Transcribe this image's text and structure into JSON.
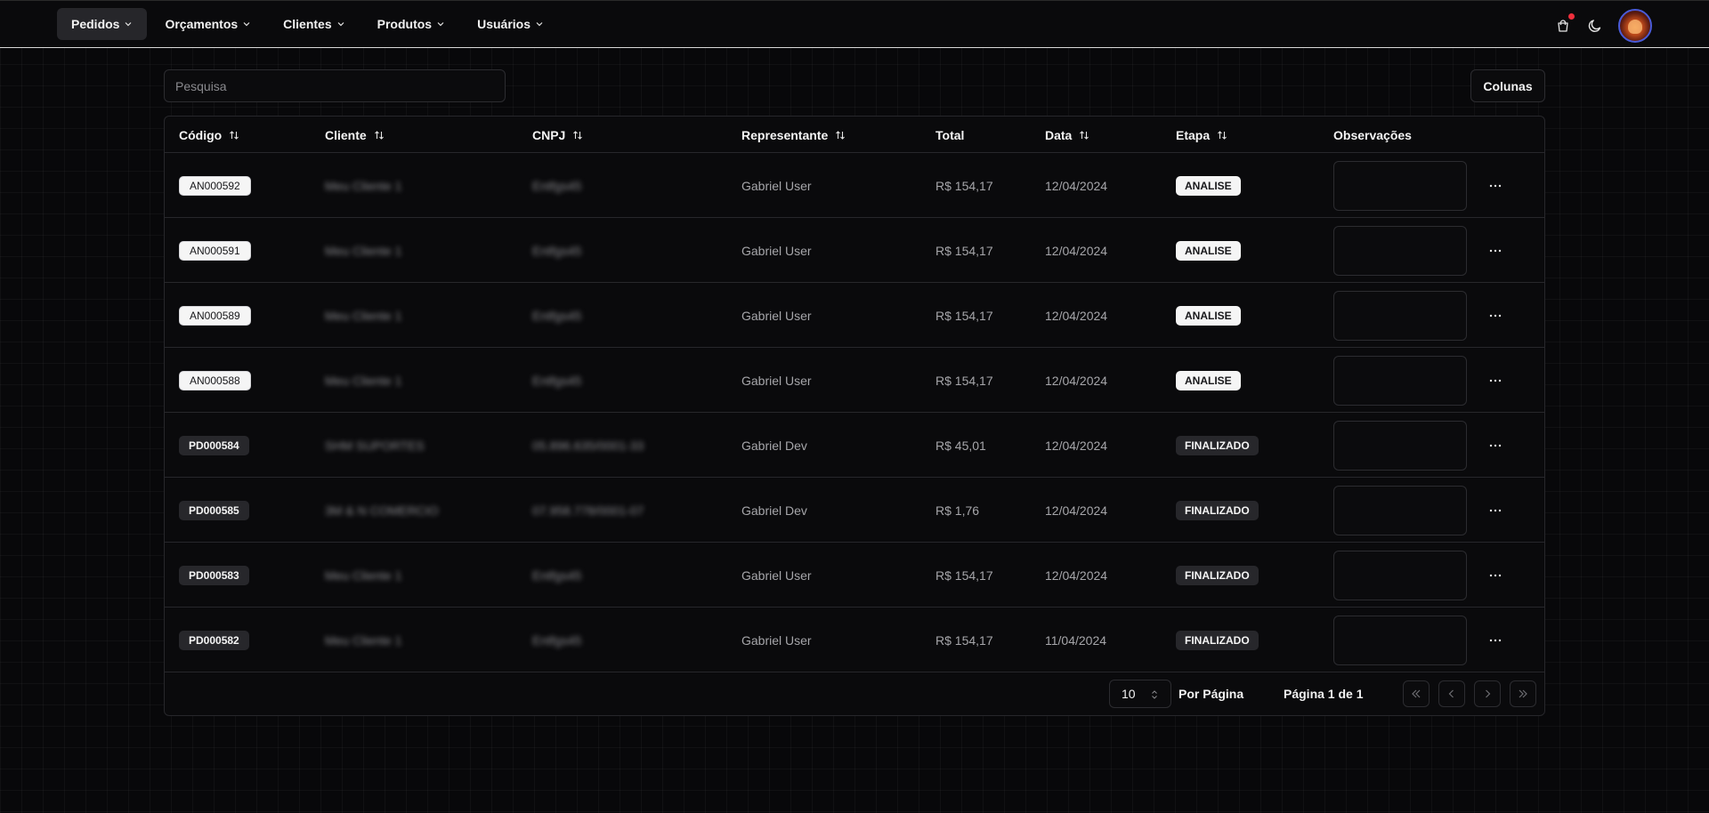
{
  "nav": {
    "items": [
      {
        "label": "Pedidos",
        "active": true
      },
      {
        "label": "Orçamentos",
        "active": false
      },
      {
        "label": "Clientes",
        "active": false
      },
      {
        "label": "Produtos",
        "active": false
      },
      {
        "label": "Usuários",
        "active": false
      }
    ],
    "icons": [
      "cart-icon",
      "moon-icon"
    ],
    "notification_color": "#ef2f3c"
  },
  "toolbar": {
    "search_placeholder": "Pesquisa",
    "columns_label": "Colunas"
  },
  "table": {
    "headers": {
      "code": "Código",
      "client": "Cliente",
      "cnpj": "CNPJ",
      "rep": "Representante",
      "total": "Total",
      "date": "Data",
      "stage": "Etapa",
      "obs": "Observações"
    },
    "rows": [
      {
        "code": "AN000592",
        "code_style": "light",
        "client": "Meu Cliente 1",
        "cnpj": "Entfgs45",
        "rep": "Gabriel User",
        "total": "R$ 154,17",
        "date": "12/04/2024",
        "stage": "ANALISE",
        "stage_style": "light"
      },
      {
        "code": "AN000591",
        "code_style": "light",
        "client": "Meu Cliente 1",
        "cnpj": "Entfgs45",
        "rep": "Gabriel User",
        "total": "R$ 154,17",
        "date": "12/04/2024",
        "stage": "ANALISE",
        "stage_style": "light"
      },
      {
        "code": "AN000589",
        "code_style": "light",
        "client": "Meu Cliente 1",
        "cnpj": "Entfgs45",
        "rep": "Gabriel User",
        "total": "R$ 154,17",
        "date": "12/04/2024",
        "stage": "ANALISE",
        "stage_style": "light"
      },
      {
        "code": "AN000588",
        "code_style": "light",
        "client": "Meu Cliente 1",
        "cnpj": "Entfgs45",
        "rep": "Gabriel User",
        "total": "R$ 154,17",
        "date": "12/04/2024",
        "stage": "ANALISE",
        "stage_style": "light"
      },
      {
        "code": "PD000584",
        "code_style": "dark",
        "client": "SHM SUPORTES",
        "cnpj": "05.896.635/0001-33",
        "rep": "Gabriel Dev",
        "total": "R$ 45,01",
        "date": "12/04/2024",
        "stage": "FINALIZADO",
        "stage_style": "dark"
      },
      {
        "code": "PD000585",
        "code_style": "dark",
        "client": "3M & N COMERCIO",
        "cnpj": "07.958.778/0001-07",
        "rep": "Gabriel Dev",
        "total": "R$ 1,76",
        "date": "12/04/2024",
        "stage": "FINALIZADO",
        "stage_style": "dark"
      },
      {
        "code": "PD000583",
        "code_style": "dark",
        "client": "Meu Cliente 1",
        "cnpj": "Entfgs45",
        "rep": "Gabriel User",
        "total": "R$ 154,17",
        "date": "12/04/2024",
        "stage": "FINALIZADO",
        "stage_style": "dark"
      },
      {
        "code": "PD000582",
        "code_style": "dark",
        "client": "Meu Cliente 1",
        "cnpj": "Entfgs45",
        "rep": "Gabriel User",
        "total": "R$ 154,17",
        "date": "11/04/2024",
        "stage": "FINALIZADO",
        "stage_style": "dark"
      }
    ]
  },
  "pagination": {
    "per_page_value": "10",
    "per_page_label": "Por Página",
    "page_label": "Página 1 de 1"
  }
}
